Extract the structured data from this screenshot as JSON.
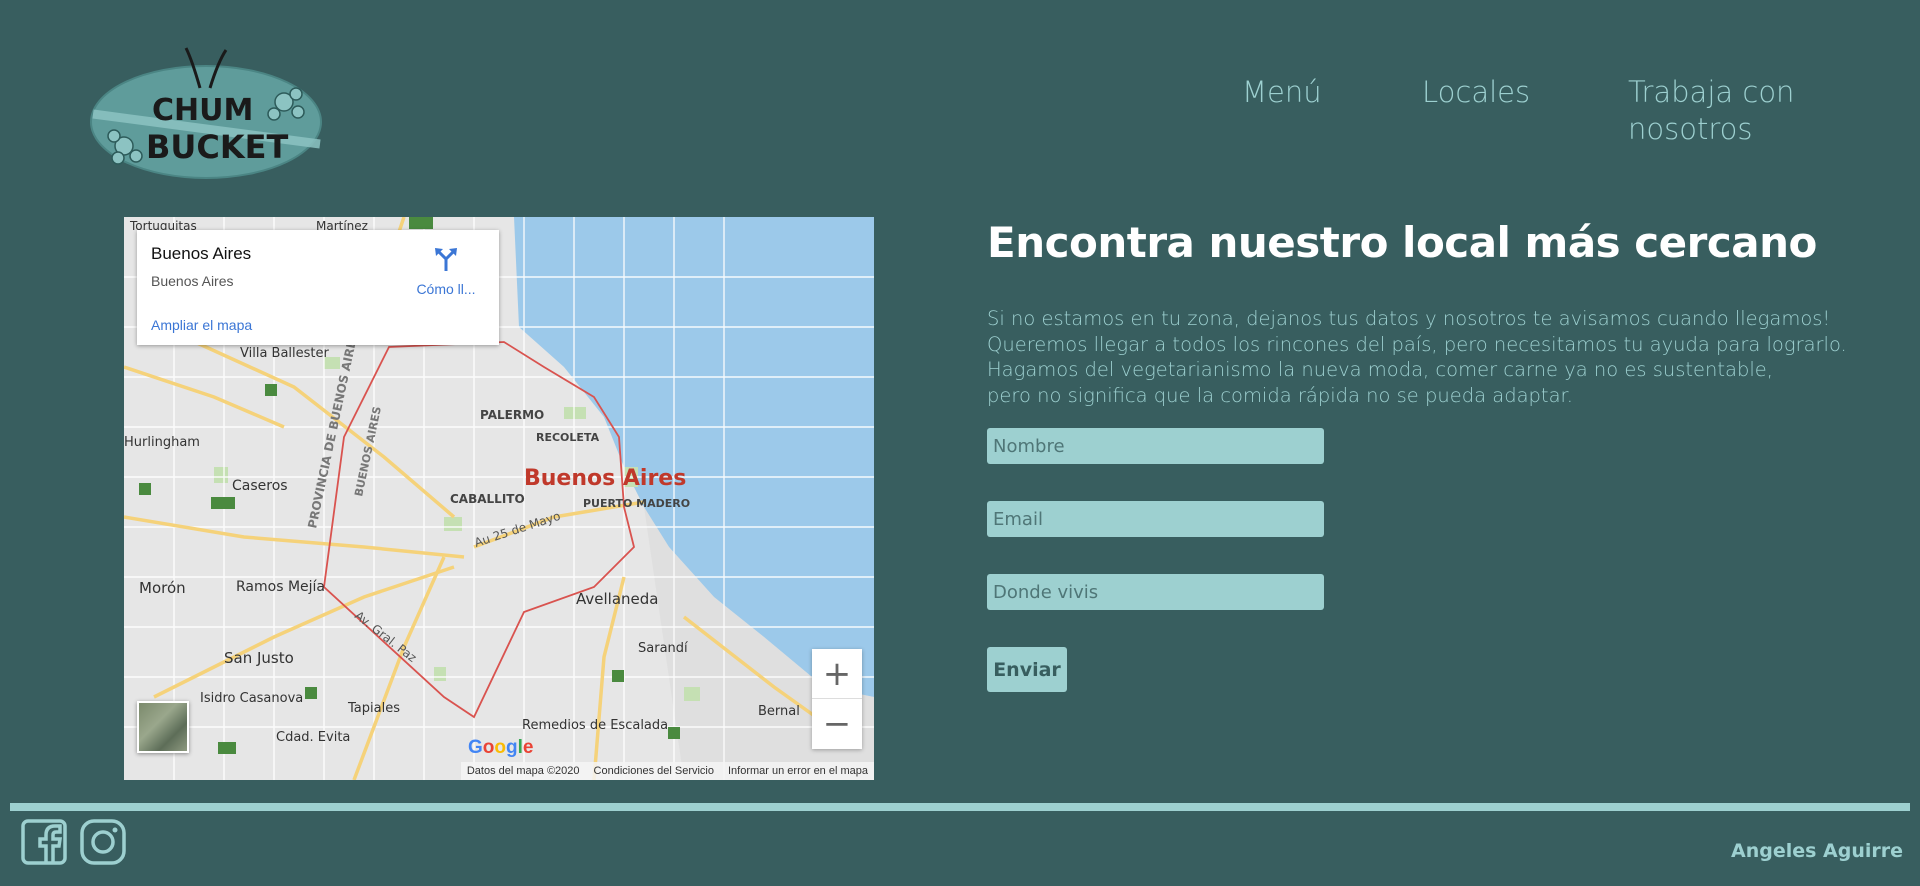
{
  "nav": {
    "items": [
      "Menú",
      "Locales",
      "Trabaja con nosotros"
    ]
  },
  "logo": {
    "text_line1": "CHUM",
    "text_line2": "BUCKET"
  },
  "map": {
    "place_title": "Buenos Aires",
    "place_subtitle": "Buenos Aires",
    "directions_label": "Cómo ll...",
    "enlarge_link": "Ampliar el mapa",
    "city_label": "Buenos Aires",
    "neighborhoods": [
      "PALERMO",
      "RECOLETA",
      "CABALLITO",
      "PUERTO MADERO",
      "Avellaneda",
      "Sarandí",
      "Caseros",
      "Villa Ballester",
      "Morón",
      "Ramos Mejía",
      "San Justo",
      "Isidro Casanova",
      "Tapiales",
      "Cdad. Evita",
      "Remedios de Escalada",
      "Bernal",
      "Hurlingham",
      "Martínez",
      "Tortuguitas"
    ],
    "roads": [
      "Au 25 de Mayo",
      "Av. Gral. Paz",
      "PROVINCIA DE BUENOS AIRES",
      "BUENOS AIRES"
    ],
    "zoom_in": "+",
    "zoom_out": "−",
    "google_logo": "Google",
    "attribution": [
      "Datos del mapa ©2020",
      "Condiciones del Servicio",
      "Informar un error en el mapa"
    ]
  },
  "content": {
    "heading": "Encontra nuestro local más cercano",
    "paragraph_lines": [
      "Si no estamos en tu zona, dejanos tus datos y nosotros te avisamos cuando llegamos!",
      "Queremos llegar a todos los rincones del país, pero necesitamos tu ayuda para lograrlo.",
      "Hagamos del vegetarianismo la nueva moda, comer carne ya no es sustentable,",
      "pero no significa que la comida rápida no se pueda adaptar."
    ]
  },
  "form": {
    "name_placeholder": "Nombre",
    "email_placeholder": "Email",
    "location_placeholder": "Donde vivis",
    "submit_label": "Enviar"
  },
  "footer": {
    "social_icons": [
      "facebook-icon",
      "instagram-icon"
    ],
    "author": "Angeles Aguirre"
  },
  "colors": {
    "background": "#385e5f",
    "accent": "#9dd0d0",
    "heading": "#ffffff"
  }
}
